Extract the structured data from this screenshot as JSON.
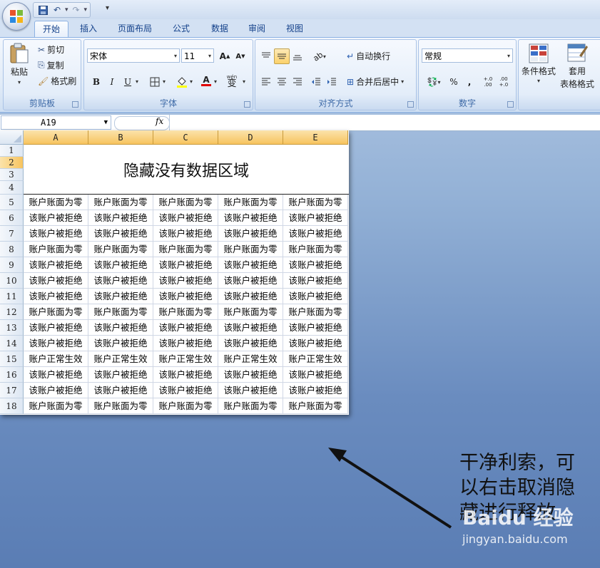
{
  "qat": {
    "more": "▾"
  },
  "tabs": [
    {
      "label": "开始",
      "active": true
    },
    {
      "label": "插入"
    },
    {
      "label": "页面布局"
    },
    {
      "label": "公式"
    },
    {
      "label": "数据"
    },
    {
      "label": "审阅"
    },
    {
      "label": "视图"
    }
  ],
  "ribbon": {
    "clipboard": {
      "label": "剪贴板",
      "paste": "粘贴",
      "cut": "剪切",
      "copy": "复制",
      "format_painter": "格式刷"
    },
    "font": {
      "label": "字体",
      "font_name": "宋体",
      "font_size": "11",
      "bold": "B",
      "italic": "I",
      "underline": "U",
      "grow": "A",
      "shrink": "A",
      "wen": "wén",
      "wen_char": "变",
      "font_color_letter": "A"
    },
    "alignment": {
      "label": "对齐方式",
      "wrap_text": "自动换行",
      "merge_center": "合并后居中"
    },
    "number": {
      "label": "数字",
      "format": "常规",
      "percent": "%",
      "comma": ",",
      "inc_decimal": "+.0 .00",
      "dec_decimal": ".00 +.0"
    },
    "styles": {
      "conditional": "条件格式",
      "table_format_1": "套用",
      "table_format_2": "表格格式"
    }
  },
  "formula_bar": {
    "name_box": "A19",
    "fx": "fx"
  },
  "sheet": {
    "columns": [
      "A",
      "B",
      "C",
      "D",
      "E"
    ],
    "rows": [
      "1",
      "2",
      "3",
      "4",
      "5",
      "6",
      "7",
      "8",
      "9",
      "10",
      "11",
      "12",
      "13",
      "14",
      "15",
      "16",
      "17",
      "18"
    ],
    "title": "隐藏没有数据区域",
    "data": [
      [
        "账户账面为零",
        "账户账面为零",
        "账户账面为零",
        "账户账面为零",
        "账户账面为零"
      ],
      [
        "该账户被拒绝",
        "该账户被拒绝",
        "该账户被拒绝",
        "该账户被拒绝",
        "该账户被拒绝"
      ],
      [
        "该账户被拒绝",
        "该账户被拒绝",
        "该账户被拒绝",
        "该账户被拒绝",
        "该账户被拒绝"
      ],
      [
        "账户账面为零",
        "账户账面为零",
        "账户账面为零",
        "账户账面为零",
        "账户账面为零"
      ],
      [
        "该账户被拒绝",
        "该账户被拒绝",
        "该账户被拒绝",
        "该账户被拒绝",
        "该账户被拒绝"
      ],
      [
        "该账户被拒绝",
        "该账户被拒绝",
        "该账户被拒绝",
        "该账户被拒绝",
        "该账户被拒绝"
      ],
      [
        "该账户被拒绝",
        "该账户被拒绝",
        "该账户被拒绝",
        "该账户被拒绝",
        "该账户被拒绝"
      ],
      [
        "账户账面为零",
        "账户账面为零",
        "账户账面为零",
        "账户账面为零",
        "账户账面为零"
      ],
      [
        "该账户被拒绝",
        "该账户被拒绝",
        "该账户被拒绝",
        "该账户被拒绝",
        "该账户被拒绝"
      ],
      [
        "该账户被拒绝",
        "该账户被拒绝",
        "该账户被拒绝",
        "该账户被拒绝",
        "该账户被拒绝"
      ],
      [
        "账户正常生效",
        "账户正常生效",
        "账户正常生效",
        "账户正常生效",
        "账户正常生效"
      ],
      [
        "该账户被拒绝",
        "该账户被拒绝",
        "该账户被拒绝",
        "该账户被拒绝",
        "该账户被拒绝"
      ],
      [
        "该账户被拒绝",
        "该账户被拒绝",
        "该账户被拒绝",
        "该账户被拒绝",
        "该账户被拒绝"
      ],
      [
        "账户账面为零",
        "账户账面为零",
        "账户账面为零",
        "账户账面为零",
        "账户账面为零"
      ]
    ]
  },
  "annotation": {
    "line1": "干净利索，可",
    "line2": "以右击取消隐",
    "line3": "藏进行释放"
  },
  "watermark": {
    "logo": "Baidu 经验",
    "url": "jingyan.baidu.com"
  }
}
